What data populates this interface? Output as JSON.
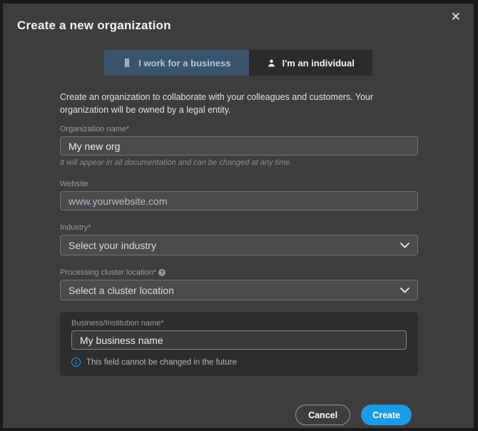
{
  "modal": {
    "title": "Create a new organization"
  },
  "icons": {
    "close": "✕",
    "help": "?",
    "info": "i"
  },
  "tabs": [
    {
      "label": "I work for a business",
      "selected": true
    },
    {
      "label": "I'm an individual",
      "selected": false
    }
  ],
  "description": "Create an organization to collaborate with your colleagues and customers. Your organization will be owned by a legal entity.",
  "fields": {
    "organization_name": {
      "label": "Organization name*",
      "value": "My new org",
      "helper": "It will appear in all documentation and can be changed at any time."
    },
    "website": {
      "label": "Website",
      "value": "www.yourwebsite.com"
    },
    "industry": {
      "label": "Industry*",
      "selected_value": "Select your industry"
    },
    "cluster_location": {
      "label": "Processing cluster location*",
      "selected_value": "Select a cluster location"
    },
    "business_name": {
      "label": "Business/Institution name*",
      "value": "My business name",
      "note": "This field cannot be changed in the future"
    }
  },
  "footer": {
    "cancel_label": "Cancel",
    "create_label": "Create"
  },
  "colors": {
    "modal_bg": "#3d3d3d",
    "panel_bg": "#2d2d2d",
    "tab_selected_bg": "#3b546c",
    "tab_selected_text": "#a9c7e6",
    "accent_blue": "#1c9be6",
    "info_blue": "#2e9bf0"
  }
}
